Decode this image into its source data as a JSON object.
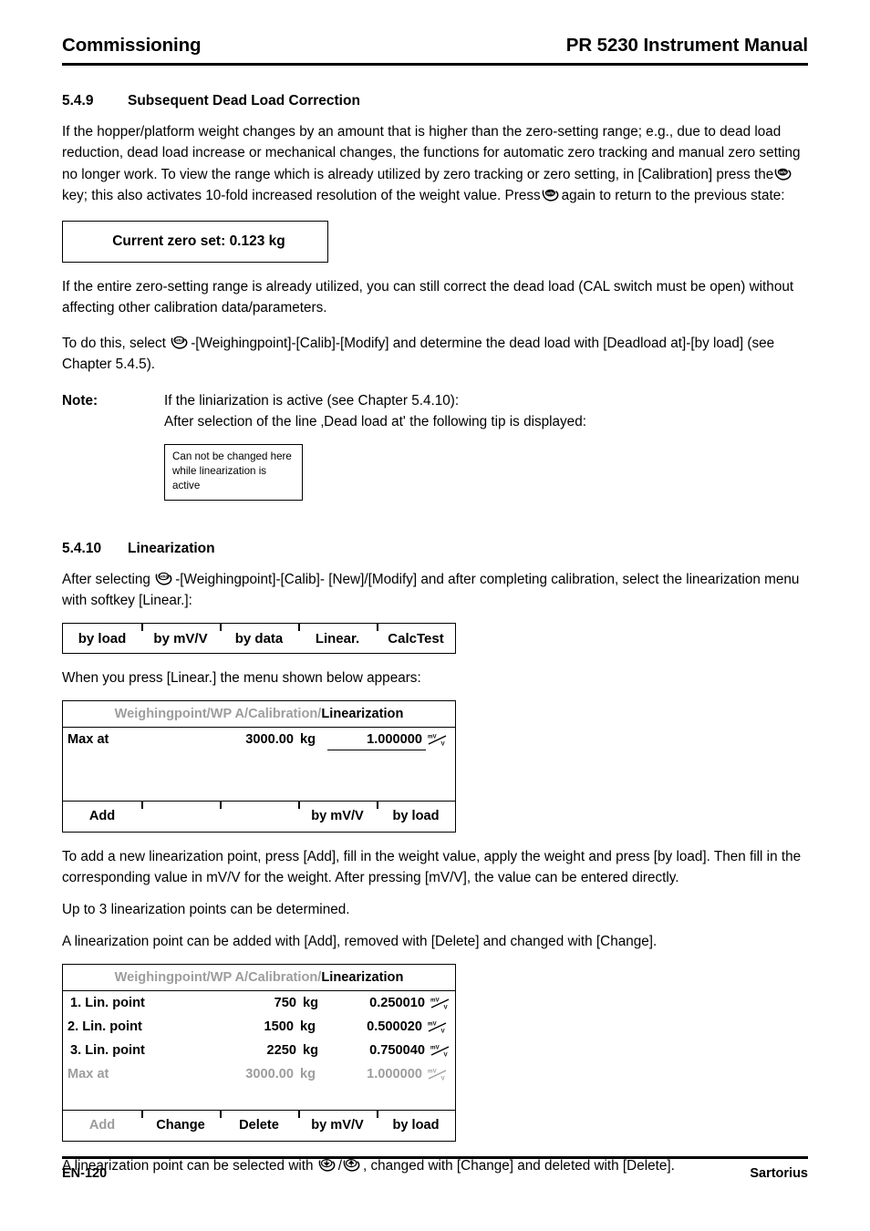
{
  "header": {
    "left": "Commissioning",
    "right": "PR 5230 Instrument Manual"
  },
  "section_549": {
    "number": "5.4.9",
    "title": "Subsequent Dead Load Correction",
    "para1_a": "If the hopper/platform weight changes by an amount that is higher than the zero-setting range; e.g., due to dead load reduction, dead load increase or mechanical changes, the functions for automatic zero tracking and manual zero setting no longer work. To view the range which is already utilized by zero tracking or zero setting, in [Calibration] press the",
    "para1_b": "key; this also activates 10-fold increased resolution of the weight value. Press",
    "para1_c": "again to return to the previous state:",
    "zero_box_text": "Current zero set: 0.123 kg",
    "para2": "If the entire zero-setting range is already utilized, you can still correct the dead load (CAL switch must be open) without affecting other calibration data/parameters.",
    "para3_a": "To do this, select",
    "para3_b": "-[Weighingpoint]-[Calib]-[Modify] and determine the dead load with [Deadload at]-[by load] (see Chapter 5.4.5).",
    "note_label": "Note:",
    "note_line1": "If the liniarization is active (see Chapter 5.4.10):",
    "note_line2": "After selection of the line ‚Dead load at' the following tip is displayed:",
    "tip_line1": "Can not be changed here",
    "tip_line2": "while linearization is active"
  },
  "section_5410": {
    "number": "5.4.10",
    "title": "Linearization",
    "para1_a": "After selecting",
    "para1_b": "-[Weighingpoint]-[Calib]- [New]/[Modify] and after completing calibration, select the linearization menu with softkey [Linear.]:",
    "softkeys": [
      "by load",
      "by mV/V",
      "by data",
      "Linear.",
      "CalcTest"
    ],
    "para2": "When you press [Linear.] the menu shown below appears:",
    "screen1": {
      "breadcrumb_dim": "Weighingpoint/WP A/Calibration/",
      "breadcrumb_current": "Linearization",
      "rows": [
        {
          "label": "Max at",
          "weight": "3000.00",
          "unit": "kg",
          "mv": "1.000000",
          "mv_unit": "mV/V",
          "highlight": "full",
          "field": true,
          "dim": false
        }
      ],
      "softkeys": [
        {
          "label": "Add",
          "dim": false
        },
        {
          "label": "",
          "dim": false
        },
        {
          "label": "",
          "dim": false
        },
        {
          "label": "by mV/V",
          "dim": false
        },
        {
          "label": "by load",
          "dim": false
        }
      ]
    },
    "para3": "To add a new linearization point, press [Add], fill in the weight value, apply the weight and press [by load]. Then fill in the corresponding value in mV/V for the weight. After pressing [mV/V], the value can be entered directly.",
    "para4": "Up to 3 linearization points can be determined.",
    "para5": "A linearization point can be added with [Add], removed with [Delete] and changed with [Change].",
    "screen2": {
      "breadcrumb_dim": "Weighingpoint/WP A/Calibration/",
      "breadcrumb_current": "Linearization",
      "rows": [
        {
          "label": "1. Lin. point",
          "weight": "750",
          "unit": "kg",
          "mv": "0.250010",
          "mv_unit": "mV/V",
          "highlight": "left",
          "field": false,
          "dim": false
        },
        {
          "label": "2. Lin. point",
          "weight": "1500",
          "unit": "kg",
          "mv": "0.500020",
          "mv_unit": "mV/V",
          "highlight": "none",
          "field": false,
          "dim": false
        },
        {
          "label": "3. Lin. point",
          "weight": "2250",
          "unit": "kg",
          "mv": "0.750040",
          "mv_unit": "mV/V",
          "highlight": "right",
          "field": false,
          "dim": false
        },
        {
          "label": "Max at",
          "weight": "3000.00",
          "unit": "kg",
          "mv": "1.000000",
          "mv_unit": "mV/V",
          "highlight": "none",
          "field": false,
          "dim": true
        }
      ],
      "softkeys": [
        {
          "label": "Add",
          "dim": true
        },
        {
          "label": "Change",
          "dim": false
        },
        {
          "label": "Delete",
          "dim": false
        },
        {
          "label": "by mV/V",
          "dim": false
        },
        {
          "label": "by load",
          "dim": false
        }
      ]
    },
    "para6_a": "A linearization point can be selected with",
    "para6_b": ", changed with [Change] and deleted with [Delete]."
  },
  "icons": {
    "info_key": "info-key",
    "setup_key": "setup-key",
    "down_key": "down-arrow-key",
    "up_key": "up-arrow-key",
    "mvv_unit": "mv-per-v-unit"
  },
  "footer": {
    "left": "EN-120",
    "right": "Sartorius"
  },
  "colors": {
    "highlight_gray": "#c3c3c3",
    "dim_gray": "#9d9d9d",
    "text": "#000000"
  }
}
